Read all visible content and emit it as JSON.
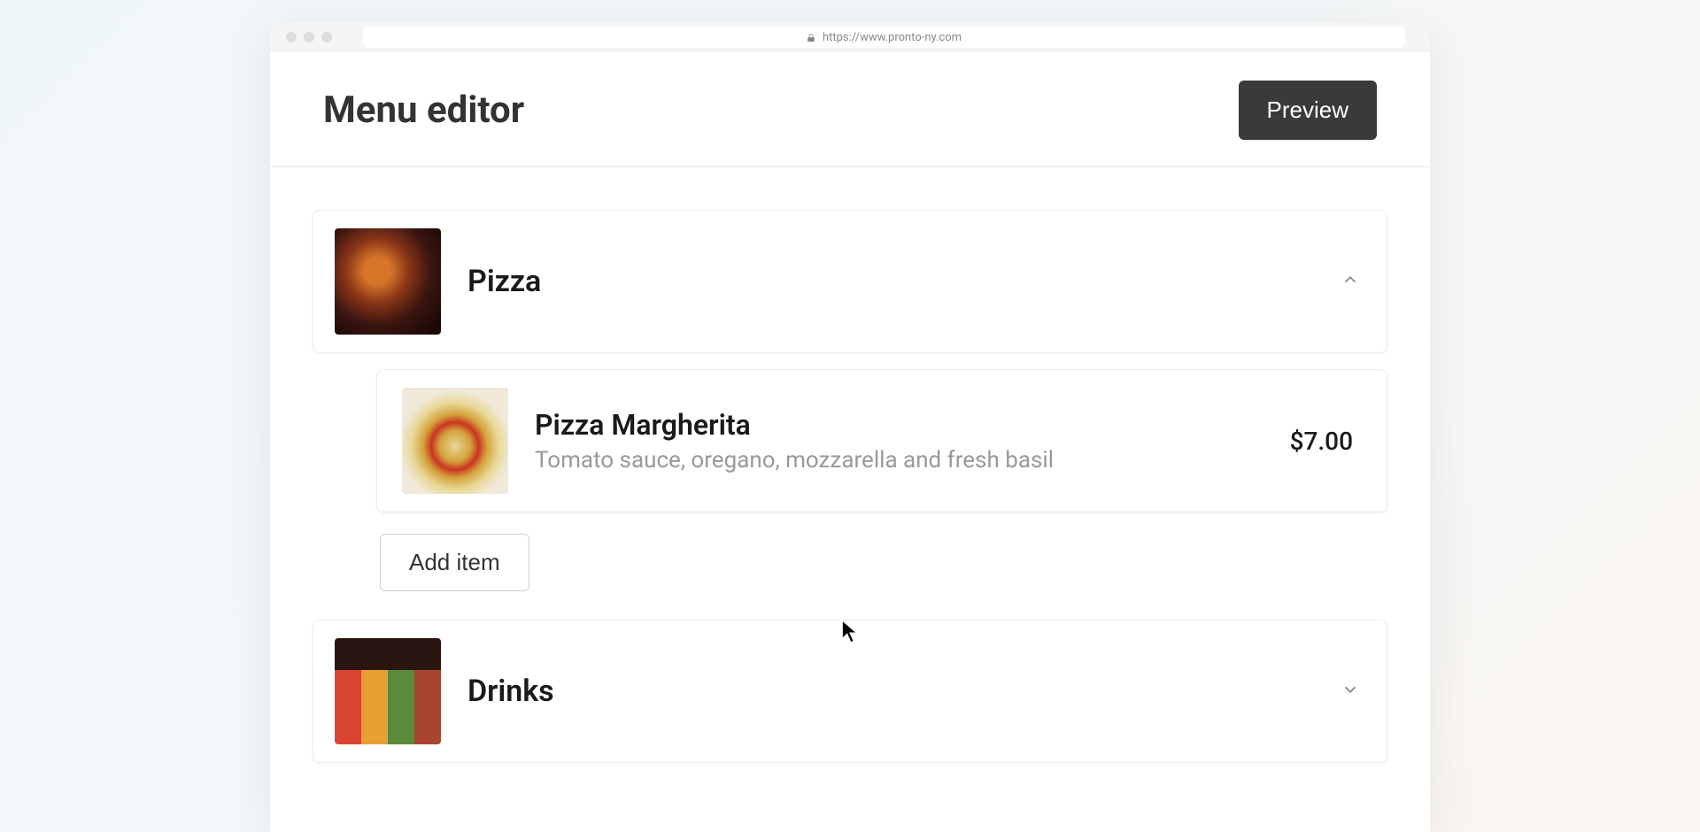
{
  "browser": {
    "url": "https://www.pronto-ny.com"
  },
  "header": {
    "title": "Menu editor",
    "preview_label": "Preview"
  },
  "categories": [
    {
      "name": "Pizza",
      "expanded": true,
      "items": [
        {
          "name": "Pizza Margherita",
          "description": "Tomato sauce, oregano, mozzarella and fresh basil",
          "price": "$7.00"
        }
      ],
      "add_item_label": "Add item"
    },
    {
      "name": "Drinks",
      "expanded": false
    }
  ]
}
